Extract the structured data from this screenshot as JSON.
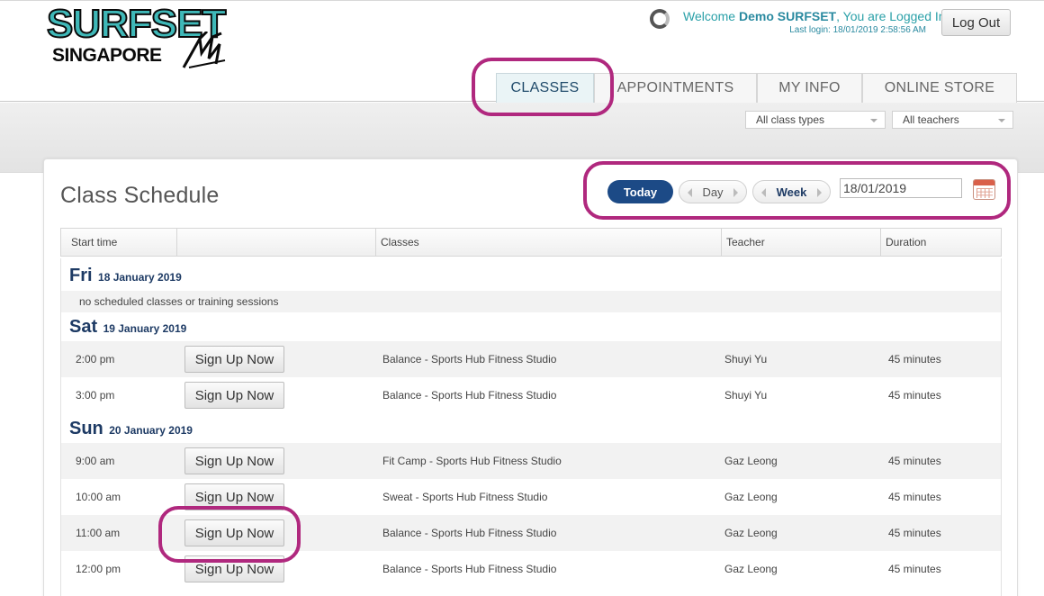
{
  "brand": {
    "line1": "SURFSET",
    "line2": "SINGAPORE"
  },
  "user": {
    "welcome_prefix": "Welcome",
    "name": "Demo SURFSET",
    "welcome_suffix": ", You are Logged In",
    "last_login": "Last login: 18/01/2019 2:58:56 AM",
    "logout_label": "Log Out"
  },
  "tabs": [
    {
      "label": "CLASSES",
      "active": true
    },
    {
      "label": "APPOINTMENTS"
    },
    {
      "label": "MY INFO"
    },
    {
      "label": "ONLINE STORE"
    }
  ],
  "filters": {
    "class_type": "All class types",
    "teacher": "All teachers"
  },
  "schedule": {
    "title": "Class Schedule",
    "today_label": "Today",
    "day_label": "Day",
    "week_label": "Week",
    "date": "18/01/2019",
    "columns": [
      "Start time",
      "",
      "Classes",
      "Teacher",
      "Duration"
    ],
    "signup_label": "Sign Up Now",
    "days": [
      {
        "name": "Fri",
        "date": "18 January 2019",
        "note": "no scheduled classes or training sessions",
        "classes": []
      },
      {
        "name": "Sat",
        "date": "19 January 2019",
        "classes": [
          {
            "time": "2:00 pm",
            "class": "Balance - Sports Hub Fitness Studio",
            "teacher": "Shuyi Yu",
            "duration": "45 minutes"
          },
          {
            "time": "3:00 pm",
            "class": "Balance - Sports Hub Fitness Studio",
            "teacher": "Shuyi Yu",
            "duration": "45 minutes"
          }
        ]
      },
      {
        "name": "Sun",
        "date": "20 January 2019",
        "classes": [
          {
            "time": "9:00 am",
            "class": "Fit Camp - Sports Hub Fitness Studio",
            "teacher": "Gaz Leong",
            "duration": "45 minutes"
          },
          {
            "time": "10:00 am",
            "class": "Sweat - Sports Hub Fitness Studio",
            "teacher": "Gaz Leong",
            "duration": "45 minutes"
          },
          {
            "time": "11:00 am",
            "class": "Balance - Sports Hub Fitness Studio",
            "teacher": "Gaz Leong",
            "duration": "45 minutes"
          },
          {
            "time": "12:00 pm",
            "class": "Balance - Sports Hub Fitness Studio",
            "teacher": "Gaz Leong",
            "duration": "45 minutes"
          }
        ]
      }
    ]
  },
  "colors": {
    "highlight_ring": "#b0287e",
    "today_button": "#1c4a86",
    "day_heading": "#1d3a64",
    "welcome_text": "#2aa0a8"
  }
}
